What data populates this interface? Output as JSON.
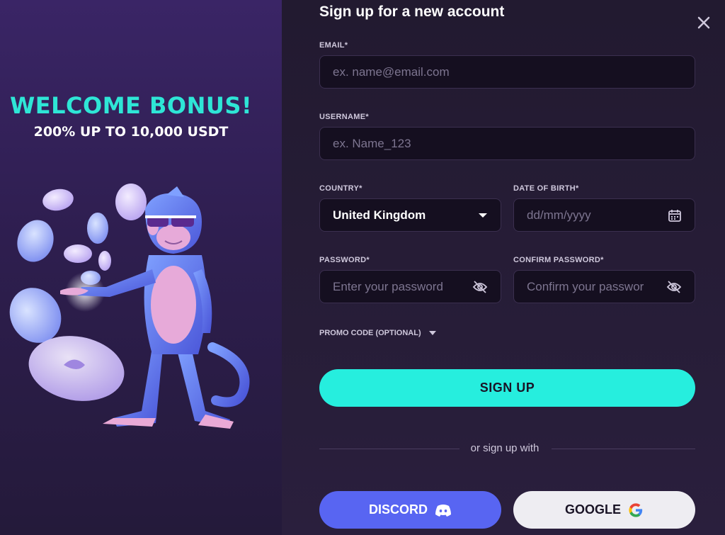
{
  "promo": {
    "title": "WELCOME BONUS!",
    "subtitle": "200% UP TO 10,000 USDT"
  },
  "form": {
    "title": "Sign up for a new account",
    "email": {
      "label": "EMAIL*",
      "placeholder": "ex. name@email.com"
    },
    "username": {
      "label": "USERNAME*",
      "placeholder": "ex. Name_123"
    },
    "country": {
      "label": "COUNTRY*",
      "value": "United Kingdom"
    },
    "dob": {
      "label": "DATE OF BIRTH*",
      "placeholder": "dd/mm/yyyy"
    },
    "password": {
      "label": "PASSWORD*",
      "placeholder": "Enter your password"
    },
    "confirm_password": {
      "label": "CONFIRM PASSWORD*",
      "placeholder": "Confirm your passwor"
    },
    "promo_code": "PROMO CODE (OPTIONAL)",
    "submit": "SIGN UP",
    "divider": "or sign up with",
    "discord": "DISCORD",
    "google": "GOOGLE"
  },
  "colors": {
    "accent": "#26eede",
    "discord": "#5865f2",
    "bonus_title": "#2ee6d6"
  },
  "icons": [
    "close-icon",
    "chevron-down-icon",
    "calendar-icon",
    "eye-off-icon",
    "discord-icon",
    "google-icon"
  ]
}
